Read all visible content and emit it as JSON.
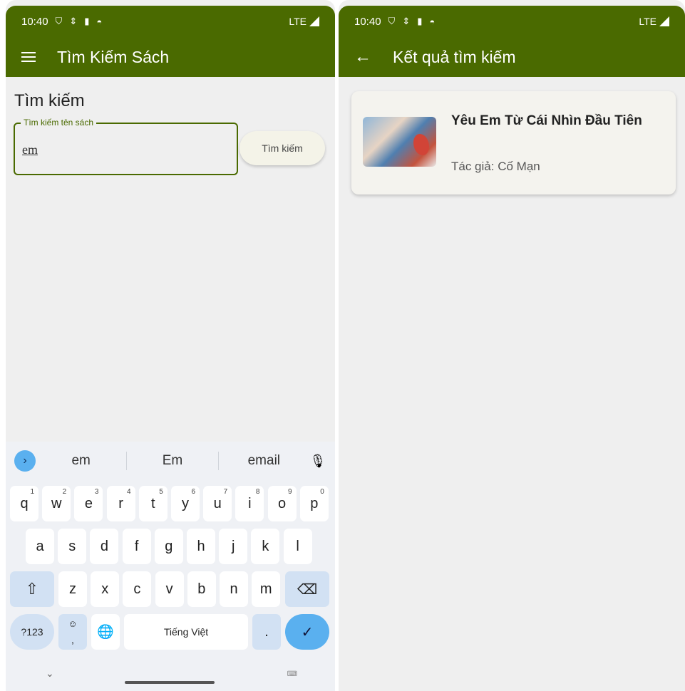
{
  "left_screen": {
    "status": {
      "time": "10:40",
      "network": "LTE"
    },
    "appbar": {
      "title": "Tìm Kiếm Sách"
    },
    "search": {
      "heading": "Tìm kiếm",
      "field_label": "Tìm kiếm tên sách",
      "field_value": "em",
      "button_label": "Tìm kiếm"
    },
    "keyboard": {
      "suggestions": [
        "em",
        "Em",
        "email"
      ],
      "row1": [
        {
          "k": "q",
          "h": "1"
        },
        {
          "k": "w",
          "h": "2"
        },
        {
          "k": "e",
          "h": "3"
        },
        {
          "k": "r",
          "h": "4"
        },
        {
          "k": "t",
          "h": "5"
        },
        {
          "k": "y",
          "h": "6"
        },
        {
          "k": "u",
          "h": "7"
        },
        {
          "k": "i",
          "h": "8"
        },
        {
          "k": "o",
          "h": "9"
        },
        {
          "k": "p",
          "h": "0"
        }
      ],
      "row2": [
        "a",
        "s",
        "d",
        "f",
        "g",
        "h",
        "j",
        "k",
        "l"
      ],
      "row3": [
        "z",
        "x",
        "c",
        "v",
        "b",
        "n",
        "m"
      ],
      "symbols_label": "?123",
      "emoji_comma": ",",
      "space_label": "Tiếng Việt",
      "period_label": "."
    }
  },
  "right_screen": {
    "status": {
      "time": "10:40",
      "network": "LTE"
    },
    "appbar": {
      "title": "Kết quả tìm kiếm"
    },
    "result": {
      "title": "Yêu Em Từ Cái Nhìn Đầu Tiên",
      "author_label": "Tác giả:",
      "author": "Cố Mạn"
    }
  },
  "colors": {
    "appbar": "#4a6a00",
    "accent_blue": "#5ab0ef",
    "background": "#efefef"
  }
}
